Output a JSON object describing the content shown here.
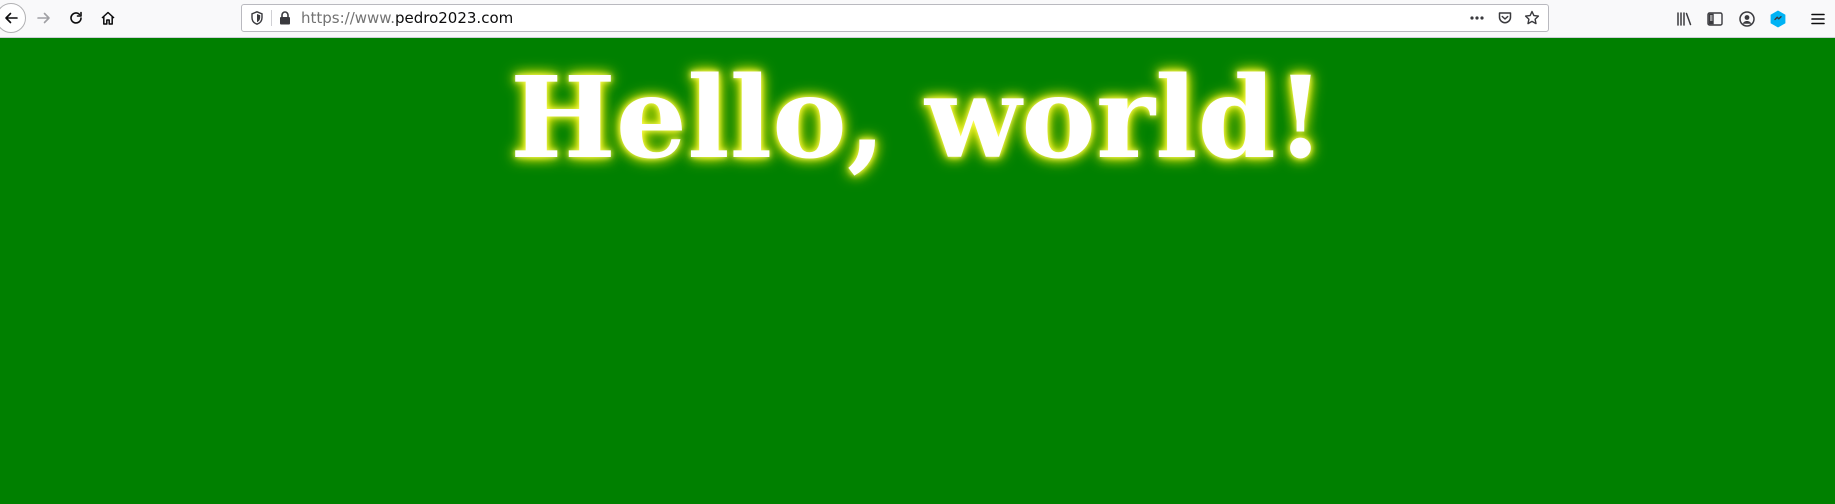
{
  "browser": {
    "url": {
      "prefix": "https://www.",
      "domain": "pedro2023.com"
    },
    "icons": {
      "back": "back-arrow-icon",
      "forward": "forward-arrow-icon",
      "reload": "reload-icon",
      "home": "home-icon",
      "tracking": "shield-icon",
      "lock": "lock-icon",
      "page_actions": "more-horizontal-icon",
      "pocket": "pocket-icon",
      "bookmark": "star-icon",
      "library": "library-icon",
      "sidebar": "sidebar-icon",
      "account": "account-icon",
      "extension": "extension-icon",
      "menu": "hamburger-menu-icon"
    },
    "colors": {
      "extension_accent": "#00b3f4"
    }
  },
  "page": {
    "heading": "Hello, world!",
    "background_color": "#008000",
    "text_color": "#ffffff",
    "glow_color": "#f3f300"
  }
}
